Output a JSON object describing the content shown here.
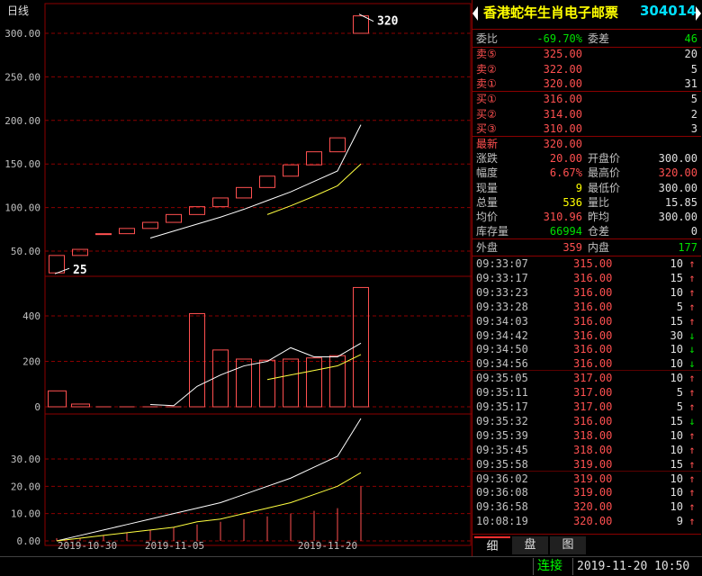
{
  "chart": {
    "period_label": "日线",
    "colors": {
      "up": "#ff5050",
      "ma1": "#ffffff",
      "ma2": "#ffff40",
      "grid": "#8b0000",
      "axis": "#c0c0c0"
    },
    "price_ticks": [
      "300.00",
      "250.00",
      "200.00",
      "150.00",
      "100.00",
      "50.00"
    ],
    "volume_ticks": [
      "400",
      "200",
      "0"
    ],
    "indicator_ticks": [
      "30.00",
      "20.00",
      "10.00",
      "0.00"
    ],
    "date_ticks": [
      "2019-10-30",
      "2019-11-05",
      "2019-11-20"
    ],
    "high_label": "320",
    "low_label": "25"
  },
  "chart_data": {
    "type": "candlestick",
    "price_ylim": [
      0,
      320
    ],
    "candles": [
      {
        "open": 25,
        "close": 45
      },
      {
        "open": 45,
        "close": 52
      },
      {
        "open": 70,
        "close": 70
      },
      {
        "open": 70,
        "close": 76
      },
      {
        "open": 76,
        "close": 83
      },
      {
        "open": 83,
        "close": 92
      },
      {
        "open": 92,
        "close": 101
      },
      {
        "open": 101,
        "close": 111
      },
      {
        "open": 111,
        "close": 123
      },
      {
        "open": 123,
        "close": 136
      },
      {
        "open": 136,
        "close": 149
      },
      {
        "open": 149,
        "close": 164
      },
      {
        "open": 164,
        "close": 180
      },
      {
        "open": 300,
        "close": 320
      }
    ],
    "ma_white": [
      null,
      null,
      null,
      null,
      65,
      73,
      81,
      89,
      98,
      108,
      118,
      130,
      142,
      195
    ],
    "ma_yellow": [
      null,
      null,
      null,
      null,
      null,
      null,
      null,
      null,
      null,
      92,
      102,
      113,
      125,
      150
    ],
    "volume_ylim": [
      0,
      520
    ],
    "volumes": [
      70,
      12,
      0,
      0,
      0,
      0,
      410,
      250,
      210,
      205,
      210,
      215,
      225,
      540
    ],
    "vol_ma_white": [
      null,
      null,
      null,
      null,
      10,
      5,
      90,
      140,
      180,
      200,
      260,
      220,
      220,
      280
    ],
    "vol_ma_yellow": [
      null,
      null,
      null,
      null,
      null,
      null,
      null,
      null,
      null,
      120,
      140,
      160,
      180,
      230
    ],
    "indicator_ylim": [
      0,
      33
    ],
    "ind_bars": [
      1,
      1,
      2,
      3,
      4,
      5,
      6,
      7,
      8,
      9,
      10,
      11,
      12,
      20
    ],
    "ind_white": [
      0,
      2,
      4,
      6,
      8,
      10,
      12,
      14,
      17,
      20,
      23,
      27,
      31,
      46
    ],
    "ind_yellow": [
      0,
      1,
      2,
      3,
      4,
      5,
      7,
      8,
      10,
      12,
      14,
      17,
      20,
      25
    ]
  },
  "panel": {
    "name": "香港蛇年生肖电子邮票",
    "code": "304014",
    "weibi": {
      "label": "委比",
      "value": "-69.70%",
      "label2": "委差",
      "value2": "46"
    },
    "sells": [
      {
        "label": "卖⑤",
        "price": "325.00",
        "vol": "20"
      },
      {
        "label": "卖②",
        "price": "322.00",
        "vol": "5"
      },
      {
        "label": "卖①",
        "price": "320.00",
        "vol": "31"
      }
    ],
    "buys": [
      {
        "label": "买①",
        "price": "316.00",
        "vol": "5"
      },
      {
        "label": "买②",
        "price": "314.00",
        "vol": "2"
      },
      {
        "label": "买③",
        "price": "310.00",
        "vol": "3"
      }
    ],
    "quote": [
      {
        "l": "最新",
        "v": "320.00",
        "vc": "red",
        "l2": "",
        "v2": "",
        "v2c": ""
      },
      {
        "l": "涨跌",
        "v": "20.00",
        "vc": "red",
        "l2": "开盘价",
        "v2": "300.00",
        "v2c": "white"
      },
      {
        "l": "幅度",
        "v": "6.67%",
        "vc": "red",
        "l2": "最高价",
        "v2": "320.00",
        "v2c": "red"
      },
      {
        "l": "现量",
        "v": "9",
        "vc": "yellow",
        "l2": "最低价",
        "v2": "300.00",
        "v2c": "white"
      },
      {
        "l": "总量",
        "v": "536",
        "vc": "yellow",
        "l2": "量比",
        "v2": "15.85",
        "v2c": "white"
      },
      {
        "l": "均价",
        "v": "310.96",
        "vc": "red",
        "l2": "昨均",
        "v2": "300.00",
        "v2c": "white"
      },
      {
        "l": "库存量",
        "v": "66994",
        "vc": "green",
        "l2": "仓差",
        "v2": "0",
        "v2c": "white"
      }
    ],
    "outer": {
      "label": "外盘",
      "value": "359",
      "label2": "内盘",
      "value2": "177"
    },
    "ticks": [
      {
        "t": "09:33:07",
        "p": "315.00",
        "v": "10",
        "d": "↑"
      },
      {
        "t": "09:33:17",
        "p": "316.00",
        "v": "15",
        "d": "↑"
      },
      {
        "t": "09:33:23",
        "p": "316.00",
        "v": "10",
        "d": "↑"
      },
      {
        "t": "09:33:28",
        "p": "316.00",
        "v": "5",
        "d": "↑"
      },
      {
        "t": "09:34:03",
        "p": "316.00",
        "v": "15",
        "d": "↑"
      },
      {
        "t": "09:34:42",
        "p": "316.00",
        "v": "30",
        "d": "↓"
      },
      {
        "t": "09:34:50",
        "p": "316.00",
        "v": "10",
        "d": "↓"
      },
      {
        "t": "09:34:56",
        "p": "316.00",
        "v": "10",
        "d": "↓"
      },
      {
        "t": "09:35:05",
        "p": "317.00",
        "v": "10",
        "d": "↑"
      },
      {
        "t": "09:35:11",
        "p": "317.00",
        "v": "5",
        "d": "↑"
      },
      {
        "t": "09:35:17",
        "p": "317.00",
        "v": "5",
        "d": "↑"
      },
      {
        "t": "09:35:32",
        "p": "316.00",
        "v": "15",
        "d": "↓"
      },
      {
        "t": "09:35:39",
        "p": "318.00",
        "v": "10",
        "d": "↑"
      },
      {
        "t": "09:35:45",
        "p": "318.00",
        "v": "10",
        "d": "↑"
      },
      {
        "t": "09:35:58",
        "p": "319.00",
        "v": "15",
        "d": "↑"
      },
      {
        "t": "09:36:02",
        "p": "319.00",
        "v": "10",
        "d": "↑"
      },
      {
        "t": "09:36:08",
        "p": "319.00",
        "v": "10",
        "d": "↑"
      },
      {
        "t": "09:36:58",
        "p": "320.00",
        "v": "10",
        "d": "↑"
      },
      {
        "t": "10:08:19",
        "p": "320.00",
        "v": "9",
        "d": "↑"
      }
    ],
    "tabs": [
      "细",
      "盘",
      "图"
    ]
  },
  "status": {
    "connection": "连接",
    "datetime": "2019-11-20  10:50"
  }
}
